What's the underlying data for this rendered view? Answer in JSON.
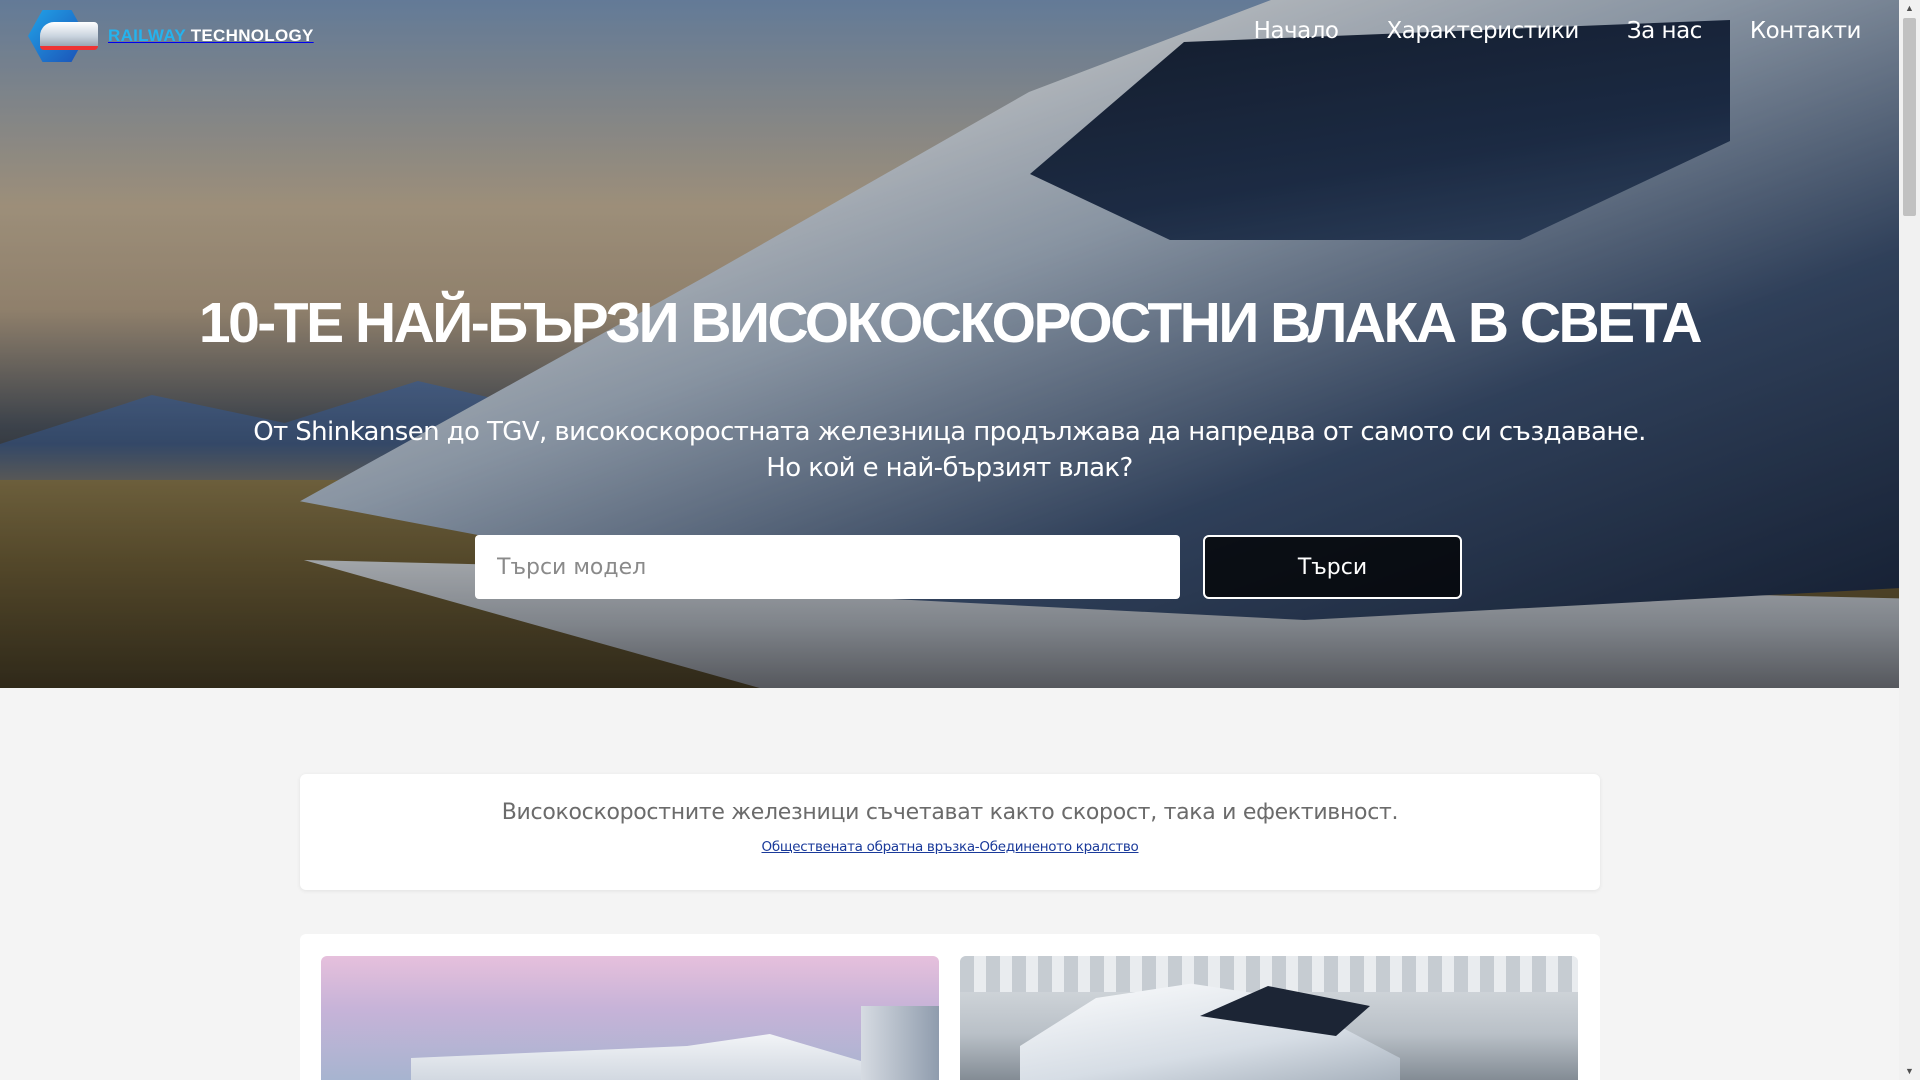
{
  "brand": {
    "part1": "RAILWAY",
    "part2": "TECHNOLOGY"
  },
  "nav": [
    "Начало",
    "Характеристики",
    "За нас",
    "Контакти"
  ],
  "hero": {
    "headline": "10-ТЕ НАЙ-БЪРЗИ ВИСОКОСКОРОСТНИ ВЛАКА В СВЕТА",
    "subtitle_line1": "От Shinkansen до TGV, високоскоростната железница продължава да напредва от самото си създаване.",
    "subtitle_line2": "Но кой е най-бързият влак?",
    "search_placeholder": "Търси модел",
    "search_button": "Търси"
  },
  "quote": {
    "text": "Високоскоростните железници съчетават както скорост, така и ефективност.",
    "source": "Обществената обратна връзка-Обединеното кралство"
  },
  "icons": {
    "logo": "train-logo-icon",
    "scroll_up": "chevron-up-icon",
    "scroll_down": "chevron-down-icon"
  },
  "colors": {
    "brand_accent": "#25b3ee",
    "link": "#1a3a9a"
  }
}
